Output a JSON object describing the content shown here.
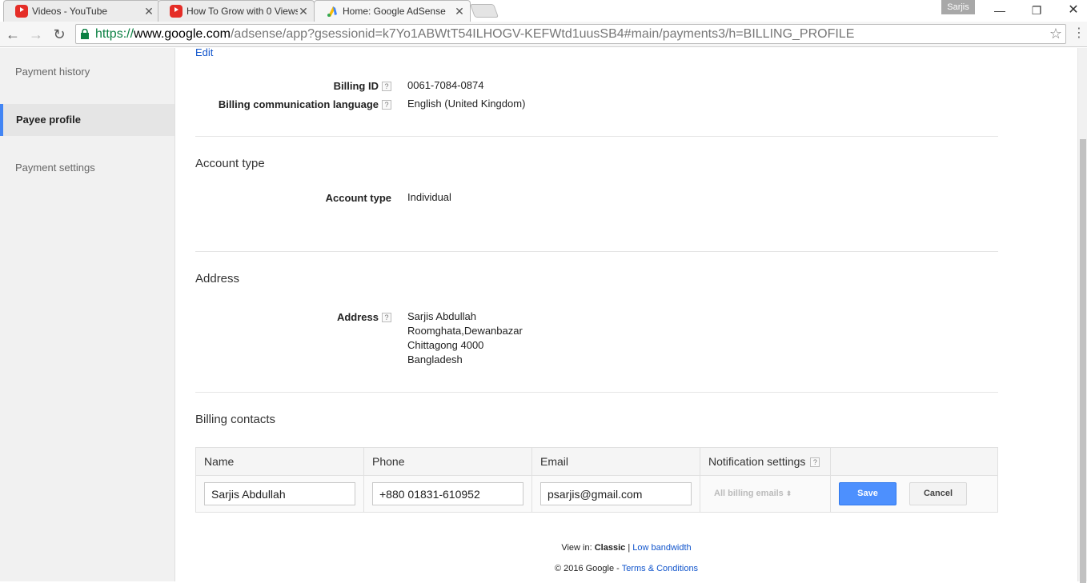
{
  "browser": {
    "tabs": [
      {
        "title": "Videos - YouTube",
        "favicon": "youtube-icon"
      },
      {
        "title": "How To Grow with 0 Views",
        "favicon": "youtube-icon"
      },
      {
        "title": "Home: Google AdSense",
        "favicon": "adsense-icon",
        "active": true
      }
    ],
    "profile_name": "Sarjis",
    "url": {
      "scheme": "https://",
      "host": "www.google.com",
      "path": "/adsense/app?gsessionid=k7Yo1ABWtT54ILHOGV-KEFWtd1uusSB4#main/payments3/h=BILLING_PROFILE"
    }
  },
  "sidebar": {
    "items": [
      {
        "label": "Payment history"
      },
      {
        "label": "Payee profile",
        "selected": true
      },
      {
        "label": "Payment settings"
      }
    ]
  },
  "profile": {
    "edit_label": "Edit",
    "billing_id_label": "Billing ID",
    "billing_id": "0061-7084-0874",
    "language_label": "Billing communication language",
    "language": "English (United Kingdom)"
  },
  "account_type": {
    "section_title": "Account type",
    "label": "Account type",
    "value": "Individual"
  },
  "address": {
    "section_title": "Address",
    "label": "Address",
    "lines": [
      "Sarjis Abdullah",
      "Roomghata,Dewanbazar",
      "Chittagong 4000",
      "Bangladesh"
    ]
  },
  "billing_contacts": {
    "section_title": "Billing contacts",
    "columns": [
      "Name",
      "Phone",
      "Email",
      "Notification settings"
    ],
    "row": {
      "name": "Sarjis Abdullah",
      "phone": "+880 01831-610952",
      "email": "psarjis@gmail.com",
      "notification": "All billing emails"
    },
    "save_label": "Save",
    "cancel_label": "Cancel"
  },
  "footer": {
    "view_in": "View in:",
    "classic": "Classic",
    "separator": "|",
    "low_bandwidth": "Low bandwidth",
    "copyright": "© 2016 Google -",
    "terms": "Terms & Conditions"
  },
  "help_glyph": "?"
}
